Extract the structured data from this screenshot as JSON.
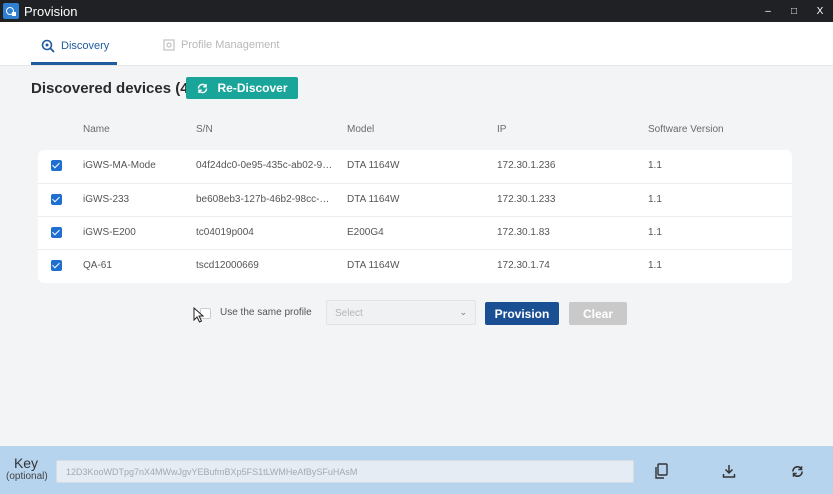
{
  "window": {
    "title": "Provision",
    "minimize": "–",
    "maximize": "□",
    "close": "X"
  },
  "tabs": [
    {
      "label": "Discovery",
      "icon": "discovery-icon",
      "active": true
    },
    {
      "label": "Profile Management",
      "icon": "profile-icon",
      "active": false
    }
  ],
  "discovery": {
    "heading": "Discovered devices (4)",
    "rediscover_label": "Re-Discover"
  },
  "table": {
    "columns": [
      "Name",
      "S/N",
      "Model",
      "IP",
      "Software Version"
    ],
    "rows": [
      {
        "checked": true,
        "name": "iGWS-MA-Mode",
        "sn": "04f24dc0-0e95-435c-ab02-9…",
        "model": "DTA 1164W",
        "ip": "172.30.1.236",
        "version": "1.1"
      },
      {
        "checked": true,
        "name": "iGWS-233",
        "sn": "be608eb3-127b-46b2-98cc-…",
        "model": "DTA 1164W",
        "ip": "172.30.1.233",
        "version": "1.1"
      },
      {
        "checked": true,
        "name": "iGWS-E200",
        "sn": "tc04019p004",
        "model": "E200G4",
        "ip": "172.30.1.83",
        "version": "1.1"
      },
      {
        "checked": true,
        "name": "QA-61",
        "sn": "tscd12000669",
        "model": "DTA 1164W",
        "ip": "172.30.1.74",
        "version": "1.1"
      }
    ]
  },
  "provision_controls": {
    "same_profile_label": "Use the same profile",
    "same_profile_checked": false,
    "select_placeholder": "Select",
    "provision_label": "Provision",
    "clear_label": "Clear"
  },
  "footer": {
    "key_label": "Key",
    "key_sublabel": "(optional)",
    "key_value": "12D3KooWDTpg7nX4MWwJgvYEBufmBXp5FS1tLWMHeAfBySFuHAsM",
    "icons": [
      "copy-icon",
      "download-icon",
      "refresh-icon"
    ]
  },
  "colors": {
    "accent_teal": "#1aa59a",
    "primary_blue": "#1b4f93",
    "tab_active": "#1f5b9f",
    "footer_bg": "#b7d4ee"
  }
}
